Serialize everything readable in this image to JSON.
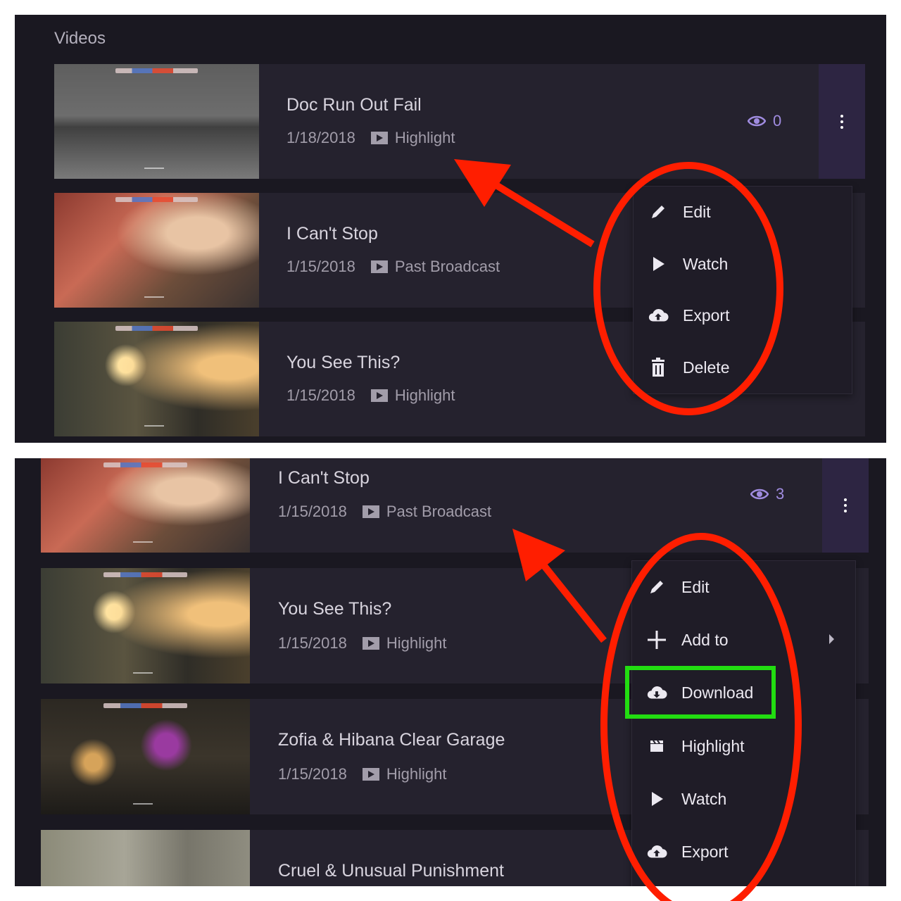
{
  "top_panel": {
    "section_title": "Videos",
    "videos": [
      {
        "title": "Doc Run Out Fail",
        "date": "1/18/2018",
        "type": "Highlight",
        "views": "0"
      },
      {
        "title": "I Can't Stop",
        "date": "1/15/2018",
        "type": "Past Broadcast"
      },
      {
        "title": "You See This?",
        "date": "1/15/2018",
        "type": "Highlight"
      }
    ],
    "menu": [
      {
        "label": "Edit",
        "icon": "pencil-icon"
      },
      {
        "label": "Watch",
        "icon": "play-icon"
      },
      {
        "label": "Export",
        "icon": "cloud-upload-icon"
      },
      {
        "label": "Delete",
        "icon": "trash-icon"
      }
    ]
  },
  "bottom_panel": {
    "videos": [
      {
        "title": "I Can't Stop",
        "date": "1/15/2018",
        "type": "Past Broadcast",
        "views": "3"
      },
      {
        "title": "You See This?",
        "date": "1/15/2018",
        "type": "Highlight"
      },
      {
        "title": "Zofia & Hibana Clear Garage",
        "date": "1/15/2018",
        "type": "Highlight"
      },
      {
        "title": "Cruel & Unusual Punishment"
      }
    ],
    "menu": [
      {
        "label": "Edit",
        "icon": "pencil-icon"
      },
      {
        "label": "Add to",
        "icon": "plus-icon",
        "has_submenu": true
      },
      {
        "label": "Download",
        "icon": "cloud-download-icon",
        "highlighted": true
      },
      {
        "label": "Highlight",
        "icon": "clapperboard-icon"
      },
      {
        "label": "Watch",
        "icon": "play-icon"
      },
      {
        "label": "Export",
        "icon": "cloud-upload-icon"
      }
    ]
  },
  "colors": {
    "panel_bg": "#1a1821",
    "row_bg": "#25222e",
    "accent_purple": "#a08ce0",
    "annotation_red": "#ff1e00",
    "annotation_green": "#22dd11"
  }
}
